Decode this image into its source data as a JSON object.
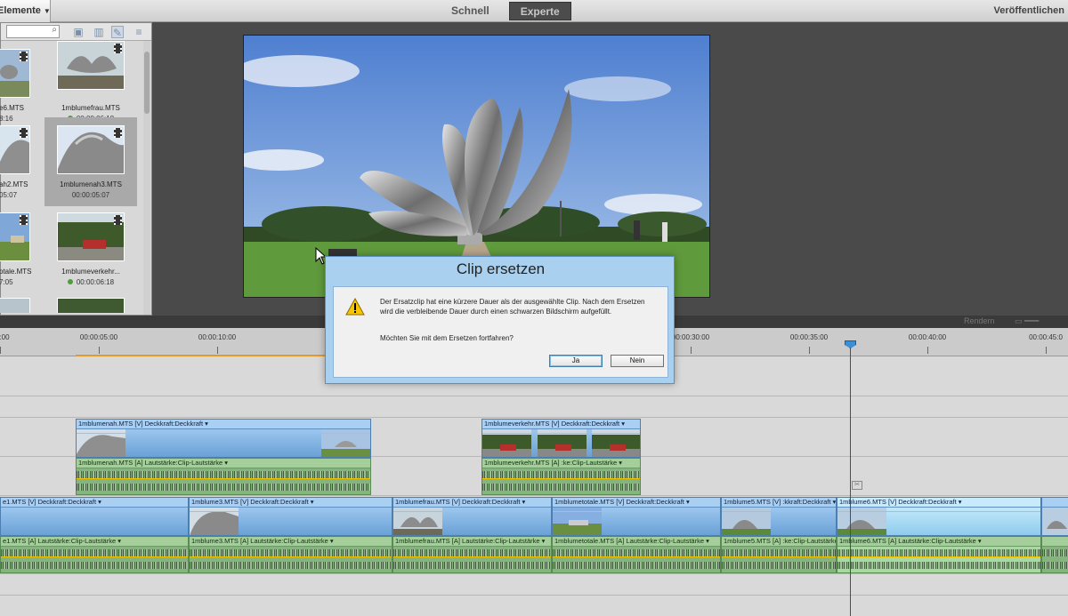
{
  "topbar": {
    "elements_menu_label": "Elemente",
    "tabs": [
      {
        "label": "Schnell",
        "active": false
      },
      {
        "label": "Experte",
        "active": true
      }
    ],
    "publish_label": "Veröffentlichen"
  },
  "media_panel": {
    "search_value": "",
    "items": [
      {
        "name": "e6.MTS",
        "duration": "8:16",
        "cut": true
      },
      {
        "name": "1mblumefrau.MTS",
        "duration": "00:00:06:18",
        "cut": false,
        "status_dot": true
      },
      {
        "name": "ah2.MTS",
        "duration": "05:07",
        "cut": true
      },
      {
        "name": "1mblumenah3.MTS",
        "duration": "00:00:05:07",
        "cut": false,
        "selected": true
      },
      {
        "name": "otale.MTS",
        "duration": "7:05",
        "cut": true
      },
      {
        "name": "1mblumeverkehr...",
        "duration": "00:00:06:18",
        "cut": false,
        "status_dot": true
      }
    ]
  },
  "timeline": {
    "render_label": "Rendern",
    "ticks": [
      {
        "label": ":00",
        "pos": 0
      },
      {
        "label": "00:00:05:00",
        "pos": 1
      },
      {
        "label": "00:00:10:00",
        "pos": 2
      },
      {
        "label": "00:00:30:00",
        "pos": 6
      },
      {
        "label": "00:00:35:00",
        "pos": 7
      },
      {
        "label": "00:00:40:00",
        "pos": 8
      },
      {
        "label": "00:00:45:0",
        "pos": 9
      }
    ],
    "upper_video": [
      {
        "label": "1mblumenah.MTS [V]  Deckkraft:Deckkraft ▾"
      },
      {
        "label": "1mblumeverkehr.MTS [V]  Deckkraft:Deckkraft ▾"
      }
    ],
    "upper_audio": [
      {
        "label": "1mblumenah.MTS [A]  Lautstärke:Clip-Lautstärke ▾"
      },
      {
        "label": "1mblumeverkehr.MTS [A]  :ke:Clip-Lautstärke ▾"
      }
    ],
    "main_video": [
      {
        "label": "e1.MTS [V]  Deckkraft:Deckkraft ▾"
      },
      {
        "label": "1mblume3.MTS [V]  Deckkraft:Deckkraft ▾"
      },
      {
        "label": "1mblumefrau.MTS [V]  Deckkraft:Deckkraft ▾"
      },
      {
        "label": "1mblumetotale.MTS [V]  Deckkraft:Deckkraft ▾"
      },
      {
        "label": "1mblume5.MTS [V]  :kkraft:Deckkraft ▾"
      },
      {
        "label": "1mblume6.MTS [V]  Deckkraft:Deckkraft ▾"
      },
      {
        "label": ""
      }
    ],
    "main_audio": [
      {
        "label": "e1.MTS [A]  Lautstärke:Clip-Lautstärke ▾"
      },
      {
        "label": "1mblume3.MTS [A]  Lautstärke:Clip-Lautstärke ▾"
      },
      {
        "label": "1mblumefrau.MTS [A]  Lautstärke:Clip-Lautstärke ▾"
      },
      {
        "label": "1mblumetotale.MTS [A]  Lautstärke:Clip-Lautstärke ▾"
      },
      {
        "label": "1mblume5.MTS [A]  :ke:Clip-Lautstärke ▾"
      },
      {
        "label": "1mblume6.MTS [A]  Lautstärke:Clip-Lautstärke ▾"
      },
      {
        "label": ""
      }
    ]
  },
  "dialog": {
    "title": "Clip ersetzen",
    "message": "Der Ersatzclip hat eine kürzere Dauer als der ausgewählte Clip. Nach dem Ersetzen wird die verbleibende Dauer durch einen schwarzen Bildschirm aufgefüllt.",
    "question": "Möchten Sie mit dem Ersetzen fortfahren?",
    "yes_label": "Ja",
    "no_label": "Nein"
  },
  "colors": {
    "video_clip": "#7fb3e0",
    "audio_clip": "#86b47f",
    "playhead": "#dd1111",
    "dialog_frame": "#a9d0ee"
  }
}
